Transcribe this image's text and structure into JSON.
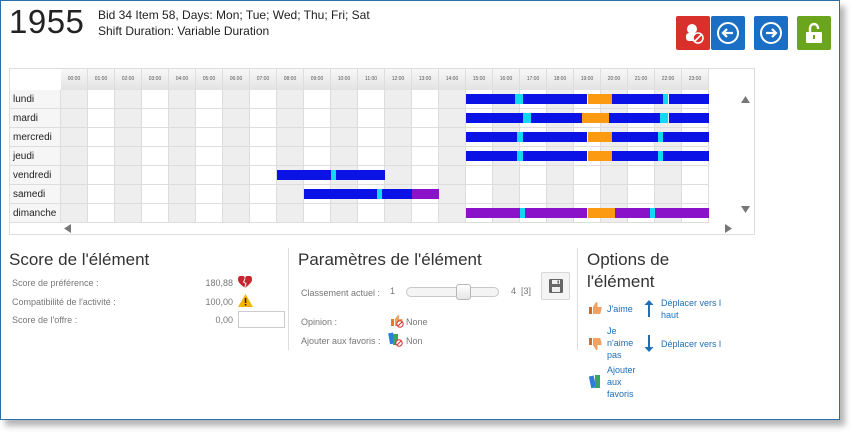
{
  "header": {
    "number": "1955",
    "line1": "Bid 34 Item 58, Days: Mon; Tue; Wed; Thu; Fri; Sat",
    "line2": "Shift Duration: Variable Duration"
  },
  "toolbar": {
    "buttons": [
      {
        "name": "no-support-icon",
        "color": "#d9302c"
      },
      {
        "name": "previous-arrow-icon",
        "color": "#1a6fc4"
      },
      {
        "name": "next-arrow-icon",
        "color": "#1a6fc4"
      },
      {
        "name": "unlock-icon",
        "color": "#6aa51c"
      }
    ]
  },
  "schedule": {
    "hours": [
      "00:00",
      "01:00",
      "02:00",
      "03:00",
      "04:00",
      "05:00",
      "06:00",
      "07:00",
      "08:00",
      "09:00",
      "10:00",
      "11:00",
      "12:00",
      "13:00",
      "14:00",
      "15:00",
      "16:00",
      "17:00",
      "18:00",
      "19:00",
      "20:00",
      "21:00",
      "22:00",
      "23:00"
    ],
    "days": [
      "lundi",
      "mardi",
      "mercredi",
      "jeudi",
      "vendredi",
      "samedi",
      "dimanche"
    ],
    "colors": {
      "work": "#0a12e6",
      "break": "#12d8f0",
      "meal": "#fc9a12",
      "alt": "#8a12c8"
    },
    "shifts": [
      {
        "day": 0,
        "segments": [
          [
            15.0,
            16.8,
            "work"
          ],
          [
            16.8,
            17.1,
            "break"
          ],
          [
            17.1,
            19.5,
            "work"
          ],
          [
            19.5,
            20.4,
            "meal"
          ],
          [
            20.4,
            22.3,
            "work"
          ],
          [
            22.3,
            22.5,
            "break"
          ],
          [
            22.5,
            24,
            "work"
          ]
        ]
      },
      {
        "day": 1,
        "segments": [
          [
            15.0,
            17.1,
            "work"
          ],
          [
            17.1,
            17.4,
            "break"
          ],
          [
            17.4,
            19.3,
            "work"
          ],
          [
            19.3,
            20.3,
            "meal"
          ],
          [
            20.3,
            22.2,
            "work"
          ],
          [
            22.2,
            22.5,
            "break"
          ],
          [
            22.5,
            24,
            "work"
          ]
        ]
      },
      {
        "day": 2,
        "segments": [
          [
            15.0,
            16.9,
            "work"
          ],
          [
            16.9,
            17.1,
            "break"
          ],
          [
            17.1,
            19.5,
            "work"
          ],
          [
            19.5,
            20.4,
            "meal"
          ],
          [
            20.4,
            22.1,
            "work"
          ],
          [
            22.1,
            22.3,
            "break"
          ],
          [
            22.3,
            24,
            "work"
          ]
        ]
      },
      {
        "day": 3,
        "segments": [
          [
            15.0,
            16.9,
            "work"
          ],
          [
            16.9,
            17.1,
            "break"
          ],
          [
            17.1,
            19.5,
            "work"
          ],
          [
            19.5,
            20.4,
            "meal"
          ],
          [
            20.4,
            22.1,
            "work"
          ],
          [
            22.1,
            22.3,
            "break"
          ],
          [
            22.3,
            24,
            "work"
          ]
        ]
      },
      {
        "day": 4,
        "segments": [
          [
            8.0,
            10.0,
            "work"
          ],
          [
            10.0,
            10.2,
            "break"
          ],
          [
            10.2,
            12.0,
            "work"
          ]
        ]
      },
      {
        "day": 5,
        "segments": [
          [
            9.0,
            11.7,
            "work"
          ],
          [
            11.7,
            11.9,
            "break"
          ],
          [
            11.9,
            13.0,
            "work"
          ],
          [
            13.0,
            14.0,
            "alt"
          ]
        ]
      },
      {
        "day": 6,
        "segments": [
          [
            15.0,
            17.0,
            "alt"
          ],
          [
            17.0,
            17.2,
            "break"
          ],
          [
            17.2,
            19.5,
            "alt"
          ],
          [
            19.5,
            20.5,
            "meal"
          ],
          [
            20.5,
            21.8,
            "alt"
          ],
          [
            21.8,
            22.0,
            "break"
          ],
          [
            22.0,
            24,
            "alt"
          ]
        ]
      }
    ]
  },
  "score": {
    "title": "Score de l'élément",
    "rows": [
      {
        "label": "Score de préférence :",
        "value": "180,88",
        "icon": "broken-heart-icon"
      },
      {
        "label": "Compatibilité de l'activité :",
        "value": "100,00",
        "icon": "warning-icon"
      },
      {
        "label": "Score de l'offre :",
        "value": "0,00",
        "icon": "score-input"
      }
    ]
  },
  "params": {
    "title": "Paramètres de l'élément",
    "rank_label": "Classement actuel :",
    "rank_min": "1",
    "rank_max": "4",
    "rank_count": "[3]",
    "rank_position": 0.63,
    "opinion_label": "Opinion :",
    "opinion_value": "None",
    "fav_label": "Ajouter aux favoris :",
    "fav_value": "Non"
  },
  "options": {
    "title_line1": "Options de",
    "title_line2": "l'élément",
    "like": "J'aime",
    "dislike_1": "Je",
    "dislike_2": "n'aime",
    "dislike_3": "pas",
    "fav_1": "Ajouter",
    "fav_2": "aux",
    "fav_3": "favoris",
    "move_up_1": "Déplacer vers l",
    "move_up_2": "haut",
    "move_down": "Déplacer vers l"
  }
}
